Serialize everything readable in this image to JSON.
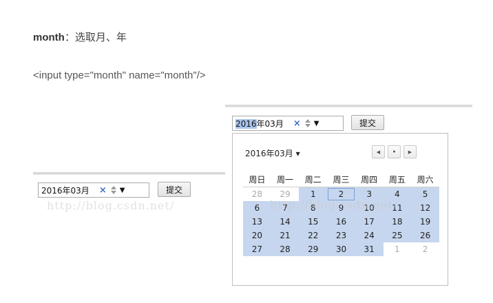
{
  "heading": {
    "keyword": "month",
    "desc": "：选取月、年"
  },
  "code_sample": "<input type=\"month\" name=\"month\"/>",
  "left_demo": {
    "value": "2016年03月",
    "clear_glyph": "×",
    "dropdown_glyph": "▼",
    "submit_label": "提交",
    "watermark": "http://blog.csdn.net/"
  },
  "right_demo": {
    "value_selected": "2016",
    "value_rest": "年03月",
    "clear_glyph": "×",
    "dropdown_glyph": "▼",
    "submit_label": "提交",
    "watermark": "http://blog.csdn.net/"
  },
  "calendar": {
    "month_label": "2016年03月",
    "month_menu_glyph": "▾",
    "nav": {
      "prev": "◀",
      "today": "●",
      "next": "▶"
    },
    "weekdays": [
      "周日",
      "周一",
      "周二",
      "周三",
      "周四",
      "周五",
      "周六"
    ],
    "weeks": [
      [
        "28",
        "29",
        "1",
        "2",
        "3",
        "4",
        "5"
      ],
      [
        "6",
        "7",
        "8",
        "9",
        "10",
        "11",
        "12"
      ],
      [
        "13",
        "14",
        "15",
        "16",
        "17",
        "18",
        "19"
      ],
      [
        "20",
        "21",
        "22",
        "23",
        "24",
        "25",
        "26"
      ],
      [
        "27",
        "28",
        "29",
        "30",
        "31",
        "1",
        "2"
      ]
    ],
    "outside_cells": [
      [
        0,
        0
      ],
      [
        0,
        1
      ],
      [
        4,
        5
      ],
      [
        4,
        6
      ]
    ],
    "today_cell": [
      0,
      3
    ],
    "colors": {
      "selected_month": "#c6d6ee",
      "outside_month_text": "#aaaaaa",
      "selection_highlight": "#aac4ec"
    }
  }
}
